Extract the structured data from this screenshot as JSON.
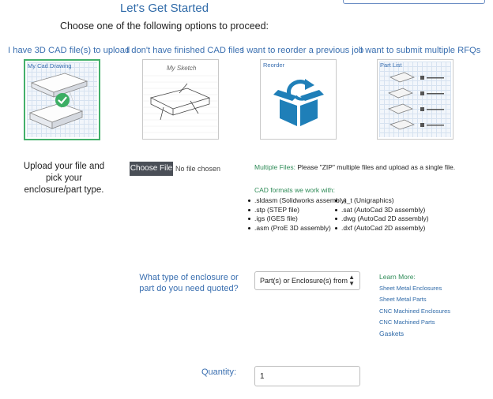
{
  "header": {
    "title": "Let's Get Started",
    "subtitle": "Choose one of the following options to proceed:"
  },
  "options": [
    {
      "label": "I have 3D CAD file(s) to upload",
      "caption": "My Cad Drawing",
      "selected": true
    },
    {
      "label": "I don't have finished CAD files",
      "caption": "My Sketch",
      "selected": false
    },
    {
      "label": "I want to reorder a previous job",
      "caption": "Reorder",
      "selected": false
    },
    {
      "label": "I want to submit multiple RFQs",
      "caption": "Part List",
      "selected": false
    }
  ],
  "upload": {
    "instructions": "Upload your file and pick your enclosure/part type.",
    "choose_button": "Choose File",
    "no_file_text": "No file chosen",
    "multiple_label": "Multiple Files:",
    "multiple_text": " Please \"ZIP\" multiple files and upload as a single file.",
    "formats_title": "CAD formats we work with:",
    "formats_left": [
      ".sldasm (Solidworks assembly)",
      ".stp (STEP file)",
      ".igs (IGES file)",
      ".asm (ProE 3D assembly)"
    ],
    "formats_right": [
      ".x_t (Unigraphics)",
      ".sat (AutoCad 3D assembly)",
      ".dwg (AutoCad 2D assembly)",
      ".dxf (AutoCad 2D assembly)"
    ]
  },
  "enclosure": {
    "question": "What type of enclosure or part do you need quoted?",
    "select_value": "Part(s) or Enclosure(s) from o",
    "learn_more_title": "Learn More:",
    "learn_more_links": [
      "Sheet Metal Enclosures",
      "Sheet Metal Parts",
      "CNC Machined Enclosures",
      "CNC Machined Parts",
      "Gaskets"
    ]
  },
  "quantity": {
    "label": "Quantity:",
    "value": "1"
  },
  "colors": {
    "accent_blue": "#2f6aa8",
    "accent_green": "#43b06a",
    "reorder_teal": "#1f7fb8"
  },
  "icons": {
    "check": "check-circle-icon",
    "reorder": "reorder-box-icon",
    "select_arrow": "updown-arrow-icon"
  }
}
